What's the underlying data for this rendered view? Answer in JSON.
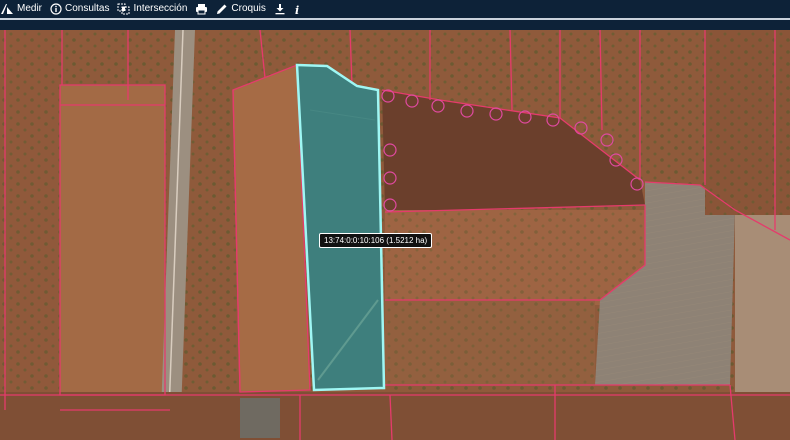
{
  "toolbar": {
    "items": [
      {
        "icon": "ruler-icon",
        "label": "Medir"
      },
      {
        "icon": "info-icon",
        "label": "Consultas"
      },
      {
        "icon": "intersection-icon",
        "label": "Intersección"
      },
      {
        "icon": "printer-icon",
        "label": ""
      },
      {
        "icon": "pencil-icon",
        "label": "Croquis"
      },
      {
        "icon": "download-icon",
        "label": ""
      },
      {
        "icon": "italic-info-icon",
        "label": ""
      }
    ]
  },
  "map": {
    "selected_parcel_label": "13:74:0:0:10:106 (1.5212 ha)",
    "colors": {
      "background_soil": "#8f5a3b",
      "parcel_border": "#e53b6c",
      "selected_fill": "#3e7f7d",
      "selected_border": "#9ff7f4",
      "buffer_circle": "#e04aa0"
    }
  }
}
